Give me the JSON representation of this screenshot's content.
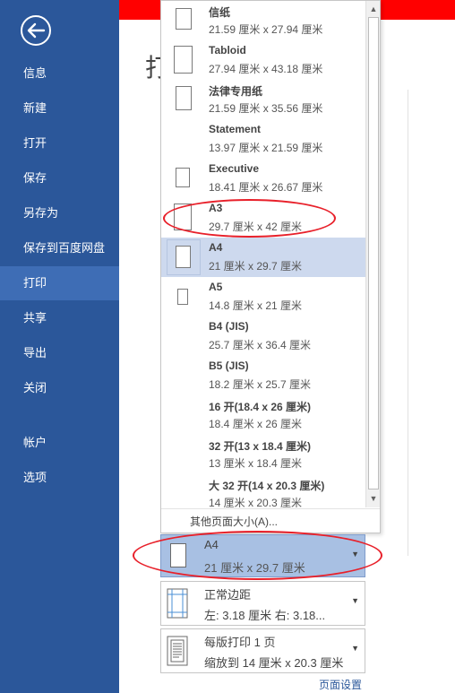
{
  "sidebar": {
    "items": [
      {
        "label": "信息",
        "selected": false
      },
      {
        "label": "新建",
        "selected": false
      },
      {
        "label": "打开",
        "selected": false
      },
      {
        "label": "保存",
        "selected": false
      },
      {
        "label": "另存为",
        "selected": false
      },
      {
        "label": "保存到百度网盘",
        "selected": false
      },
      {
        "label": "打印",
        "selected": true
      },
      {
        "label": "共享",
        "selected": false
      },
      {
        "label": "导出",
        "selected": false
      },
      {
        "label": "关闭",
        "selected": false
      },
      {
        "label": "帐户",
        "selected": false
      },
      {
        "label": "选项",
        "selected": false
      }
    ]
  },
  "main": {
    "title_glyph": "打"
  },
  "paper_sizes": [
    {
      "name": "信纸",
      "dims": "21.59 厘米 x 27.94 厘米",
      "selected": false
    },
    {
      "name": "Tabloid",
      "dims": "27.94 厘米 x 43.18 厘米",
      "selected": false
    },
    {
      "name": "法律专用纸",
      "dims": "21.59 厘米 x 35.56 厘米",
      "selected": false
    },
    {
      "name": "Statement",
      "dims": "13.97 厘米 x 21.59 厘米",
      "selected": false
    },
    {
      "name": "Executive",
      "dims": "18.41 厘米 x 26.67 厘米",
      "selected": false
    },
    {
      "name": "A3",
      "dims": "29.7 厘米 x 42 厘米",
      "selected": false
    },
    {
      "name": "A4",
      "dims": "21 厘米 x 29.7 厘米",
      "selected": true
    },
    {
      "name": "A5",
      "dims": "14.8 厘米 x 21 厘米",
      "selected": false
    },
    {
      "name": "B4 (JIS)",
      "dims": "25.7 厘米 x 36.4 厘米",
      "selected": false
    },
    {
      "name": "B5 (JIS)",
      "dims": "18.2 厘米 x 25.7 厘米",
      "selected": false
    },
    {
      "name": "16 开(18.4 x 26 厘米)",
      "dims": "18.4 厘米 x 26 厘米",
      "selected": false
    },
    {
      "name": "32 开(13 x 18.4 厘米)",
      "dims": "13 厘米 x 18.4 厘米",
      "selected": false
    },
    {
      "name": "大 32 开(14 x 20.3 厘米)",
      "dims": "14 厘米 x 20.3 厘米",
      "selected": false
    }
  ],
  "dropdown": {
    "more_sizes_label": "其他页面大小(A)...",
    "scroll_up_glyph": "▲",
    "scroll_down_glyph": "▼"
  },
  "settings": {
    "paper": {
      "line1": "A4",
      "line2": "21 厘米 x 29.7 厘米"
    },
    "margins": {
      "line1": "正常边距",
      "line2": "左: 3.18 厘米    右: 3.18..."
    },
    "pages_per_sheet": {
      "line1": "每版打印 1 页",
      "line2": "缩放到 14 厘米 x 20.3 厘米"
    },
    "arrow_glyph": "▼"
  },
  "page_setup_link": "页面设置",
  "colors": {
    "sidebar": "#2b579a",
    "sidebar_selected": "#3e6db5",
    "red_bar": "#ff0000",
    "annotation": "#e8202a",
    "selected_option": "#cdd9ee",
    "selected_setting": "#a8c0e3"
  }
}
